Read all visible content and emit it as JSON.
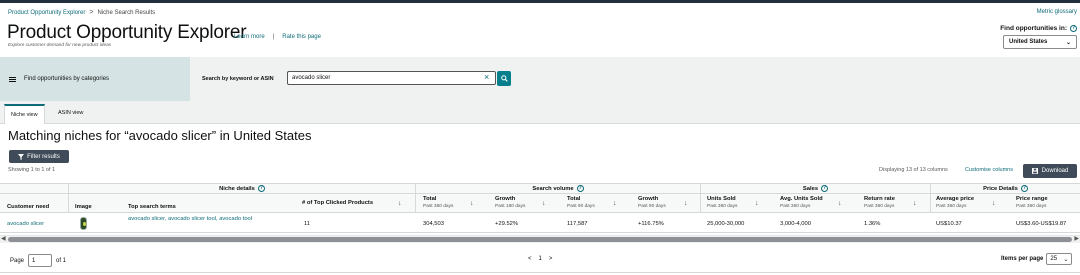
{
  "breadcrumb": {
    "root": "Product Opportunity Explorer",
    "separator": ">",
    "current": "Niche Search Results"
  },
  "header": {
    "glossary": "Metric glossary",
    "title": "Product Opportunity Explorer",
    "learn_more": "Learn more",
    "separator": "|",
    "rate": "Rate this page",
    "subtitle": "Explore customer demand for new product ideas",
    "find_label": "Find opportunities in:",
    "country": "United States"
  },
  "search": {
    "categories_label": "Find opportunities by categories",
    "label": "Search by keyword or ASIN",
    "value": "avocado slicer"
  },
  "tabs": [
    {
      "label": "Niche view",
      "active": true
    },
    {
      "label": "ASIN view",
      "active": false
    }
  ],
  "results": {
    "heading": "Matching niches for “avocado slicer” in United States",
    "filter_label": "Filter results",
    "showing": "Showing 1 to 1 of 1",
    "displaying": "Displaying 13 of 13 columns",
    "customise": "Customise columns",
    "download": "Download"
  },
  "table": {
    "groups": {
      "niche": "Niche details",
      "search": "Search volume",
      "sales": "Sales",
      "price": "Price Details"
    },
    "columns": {
      "customer_need": "Customer need",
      "image": "Image",
      "top_terms": "Top search terms",
      "top_clicked": "# of Top Clicked Products",
      "total360": {
        "label": "Total",
        "sub": "Past 360 days"
      },
      "growth180": {
        "label": "Growth",
        "sub": "Past 180 days"
      },
      "total90": {
        "label": "Total",
        "sub": "Past 90 days"
      },
      "growth90": {
        "label": "Growth",
        "sub": "Past 90 days"
      },
      "units_sold": {
        "label": "Units Sold",
        "sub": "Past 360 days"
      },
      "avg_units": {
        "label": "Avg. Units Sold",
        "sub": "Past 360 days"
      },
      "return_rate": {
        "label": "Return rate",
        "sub": "Past 360 days"
      },
      "avg_price": {
        "label": "Average price",
        "sub": "Past 360 days"
      },
      "price_range": {
        "label": "Price range",
        "sub": "Past 360 days"
      }
    },
    "row": {
      "customer_need": "avocado slicer",
      "top_terms": "avocado slicer, avocado slicer tool, avocado tool",
      "top_clicked": "11",
      "total360": "304,503",
      "growth180": "+29.52%",
      "total90": "117,587",
      "growth90": "+116.75%",
      "units_sold": "25,000-30,000",
      "avg_units": "3,000-4,000",
      "return_rate": "1.36%",
      "avg_price": "US$10.37",
      "price_range": "US$3.60-US$19.87"
    }
  },
  "pager": {
    "page_label": "Page",
    "page_value": "1",
    "of_label": "of 1",
    "prev": "<",
    "current": "1",
    "next": ">",
    "per_page_label": "Items per page",
    "per_page_value": "25"
  }
}
